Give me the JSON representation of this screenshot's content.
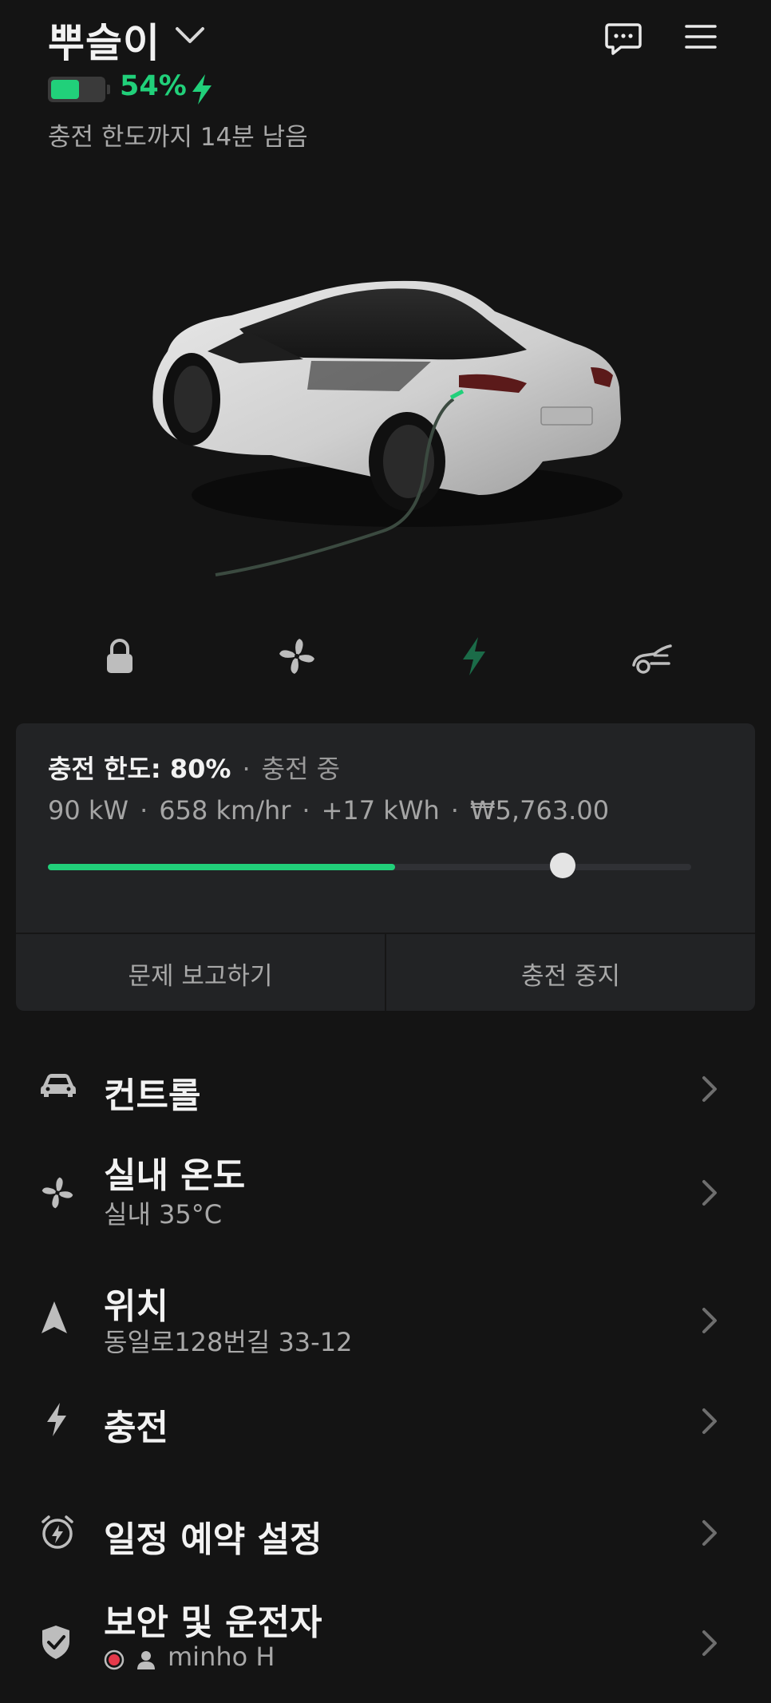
{
  "header": {
    "car_name": "뿌슬이",
    "battery_percent_label": "54%",
    "battery_level": 0.54,
    "charge_remaining": "충전 한도까지 14분 남음"
  },
  "icons": {
    "chat": "chat-bubble-icon",
    "menu": "hamburger-menu-icon",
    "lock": "lock-icon",
    "climate": "fan-icon",
    "charge": "lightning-bolt-icon",
    "frunk": "car-frunk-icon"
  },
  "colors": {
    "accent": "#21d07a",
    "charge_icon": "#1b6b48",
    "background": "#141414",
    "card": "#222325",
    "alert_red": "#e5394a"
  },
  "card": {
    "limit_label": "충전 한도: 80%",
    "status": "충전 중",
    "stats": [
      "90 kW",
      "658 km/hr",
      "+17 kWh",
      "₩5,763.00"
    ],
    "current_charge_fraction": 0.54,
    "limit_fraction": 0.8,
    "report_button": "문제 보고하기",
    "stop_button": "충전 중지"
  },
  "menu": {
    "controls": {
      "title": "컨트롤"
    },
    "climate": {
      "title": "실내 온도",
      "subtitle": "실내 35°C"
    },
    "location": {
      "title": "위치",
      "subtitle": "동일로128번길 33-12"
    },
    "charging": {
      "title": "충전"
    },
    "schedule": {
      "title": "일정 예약 설정"
    },
    "security": {
      "title": "보안 및 운전자",
      "driver": "minho H"
    }
  }
}
